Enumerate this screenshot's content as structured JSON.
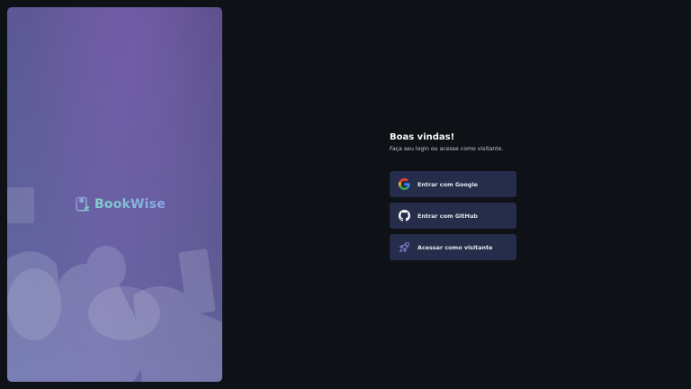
{
  "hero": {
    "brand_name": "BookWise"
  },
  "login": {
    "title": "Boas vindas!",
    "subtitle": "Faça seu login ou acesse como visitante."
  },
  "buttons": [
    {
      "label": "Entrar com Google",
      "icon": "google-icon"
    },
    {
      "label": "Entrar com GitHub",
      "icon": "github-icon"
    },
    {
      "label": "Acessar como visitante",
      "icon": "rocket-icon"
    }
  ],
  "colors": {
    "background": "#0e1116",
    "button_bg": "#252d4a",
    "accent_purple": "#8381d9",
    "logo_gradient_start": "#7fd1cc",
    "logo_gradient_end": "#8aa6e8"
  }
}
